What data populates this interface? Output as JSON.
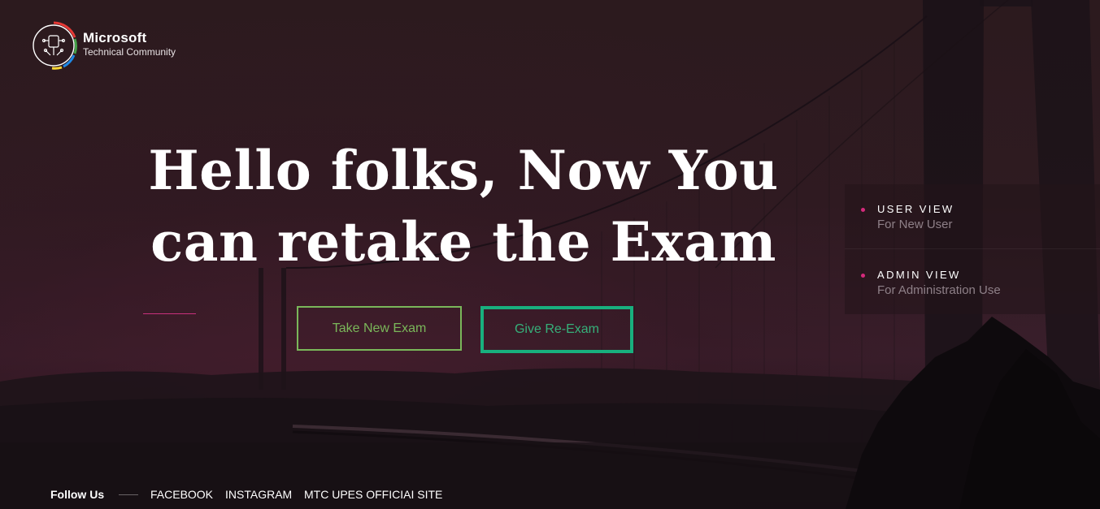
{
  "logo": {
    "line1": "Microsoft",
    "line2": "Technical Community",
    "icon": "mtc-logo-icon"
  },
  "hero": {
    "title_line1": "Hello folks, Now You",
    "title_line2": "can retake the Exam"
  },
  "buttons": {
    "take_new": "Take New Exam",
    "re_exam": "Give Re-Exam"
  },
  "side_menu": {
    "items": [
      {
        "title": "USER VIEW",
        "subtitle": "For New User"
      },
      {
        "title": "ADMIN VIEW",
        "subtitle": "For Administration Use"
      }
    ]
  },
  "footer": {
    "follow_label": "Follow Us",
    "links": [
      "FACEBOOK",
      "INSTAGRAM",
      "MTC UPES OFFICIAI SITE"
    ]
  },
  "colors": {
    "accent_pink": "#d42a7c",
    "button_green": "#7ab75a",
    "highlight_teal": "#18b07e",
    "background": "#2a1a1f"
  }
}
